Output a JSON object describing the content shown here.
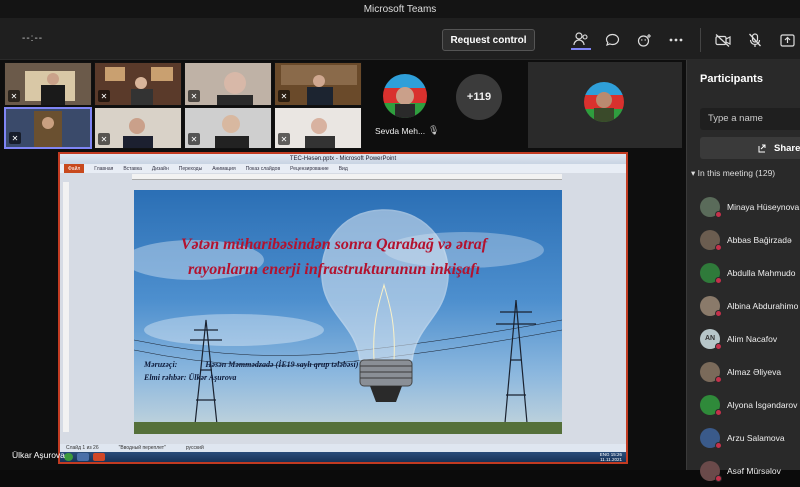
{
  "app": {
    "title": "Microsoft Teams"
  },
  "toolbar": {
    "timer": "--:--",
    "request_control_label": "Request control",
    "icons": [
      "people-icon",
      "chat-icon",
      "reactions-icon",
      "more-icon",
      "camera-off-icon",
      "mic-off-icon",
      "share-tray-icon"
    ]
  },
  "stage": {
    "featured_name": "Sevda Meh...",
    "overflow_count": "+119",
    "presenter_name": "Ülkar Aşurova"
  },
  "powerpoint": {
    "window_title": "TEC-Həsən.pptx - Microsoft PowerPoint",
    "ribbon_tabs": [
      "Файл",
      "Главная",
      "Вставка",
      "Дизайн",
      "Переходы",
      "Анимация",
      "Показ слайдов",
      "Рецензирование",
      "Вид"
    ],
    "slide": {
      "title": "Vətən müharibəsindən sonra Qarabağ və ətraf rayonların enerji infrastrukturunun inkişafı",
      "speaker_label": "Məruzəçi:",
      "speaker": "Həsən Məmmədzadə (İE19 saylı qrup tələbəsi)",
      "advisor": "Elmi rəhbər: Ülkər Aşurova"
    },
    "status_left": "Слайд 1 из 26",
    "status_theme": "\"Вводный переплет\"",
    "status_lang": "русский",
    "clock_time": "15:26",
    "clock_date": "11.11.2021",
    "tray_lang": "ENG"
  },
  "participants": {
    "heading": "Participants",
    "search_placeholder": "Type a name",
    "share_label": "Share",
    "section_label": "In this meeting (129)",
    "list": [
      {
        "name": "Minaya Hüseynova",
        "initials": "",
        "color": "#5a6b5a"
      },
      {
        "name": "Abbas Bağirzadə",
        "initials": "",
        "color": "#6b5d50"
      },
      {
        "name": "Abdulla Mahmudo",
        "initials": "",
        "color": "#2f7a3a"
      },
      {
        "name": "Albina Abdurahimo",
        "initials": "",
        "color": "#8a7a6a"
      },
      {
        "name": "Alim Nacafov",
        "initials": "AN",
        "color": "#b7c6c9"
      },
      {
        "name": "Almaz Əliyeva",
        "initials": "",
        "color": "#7a6a5a"
      },
      {
        "name": "Alyona İsgəndarov",
        "initials": "",
        "color": "#2f8a3a"
      },
      {
        "name": "Arzu Salamova",
        "initials": "",
        "color": "#3a5a8a"
      },
      {
        "name": "Asəf Mürsəlov",
        "initials": "",
        "color": "#6a4a4a"
      }
    ]
  }
}
